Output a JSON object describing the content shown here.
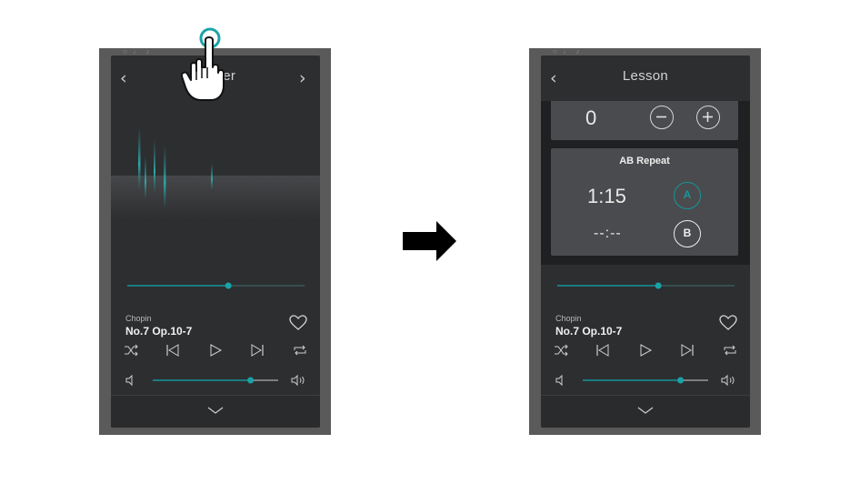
{
  "left_screen": {
    "status_icons": "○ ♩ ♪",
    "back_icon": "back-chevron",
    "forward_icon": "forward-chevron",
    "title": "Player",
    "track": {
      "artist": "Chopin",
      "title": "No.7 Op.10-7"
    },
    "seek_progress": 0.57,
    "volume_level": 0.78,
    "controls": [
      "shuffle-icon",
      "skip-previous-icon",
      "play-icon",
      "skip-next-icon",
      "repeat-icon"
    ]
  },
  "right_screen": {
    "status_icons": "○ ♩ ♪",
    "title": "Lesson",
    "tempo": {
      "value": "0",
      "minus_icon": "minus-icon",
      "plus_icon": "plus-icon"
    },
    "ab_repeat": {
      "title": "AB Repeat",
      "time_a": "1:15",
      "time_b": "--:--",
      "a_label": "A",
      "b_label": "B"
    },
    "track": {
      "artist": "Chopin",
      "title": "No.7 Op.10-7"
    },
    "seek_progress": 0.57,
    "volume_level": 0.78
  },
  "colors": {
    "accent": "#15969a",
    "screen_bg": "#2d2e30",
    "card_bg": "#4a4b4e",
    "frame": "#5a5a5a"
  },
  "transition_icon": "right-arrow-icon",
  "gesture_icon": "tap-hand-icon"
}
